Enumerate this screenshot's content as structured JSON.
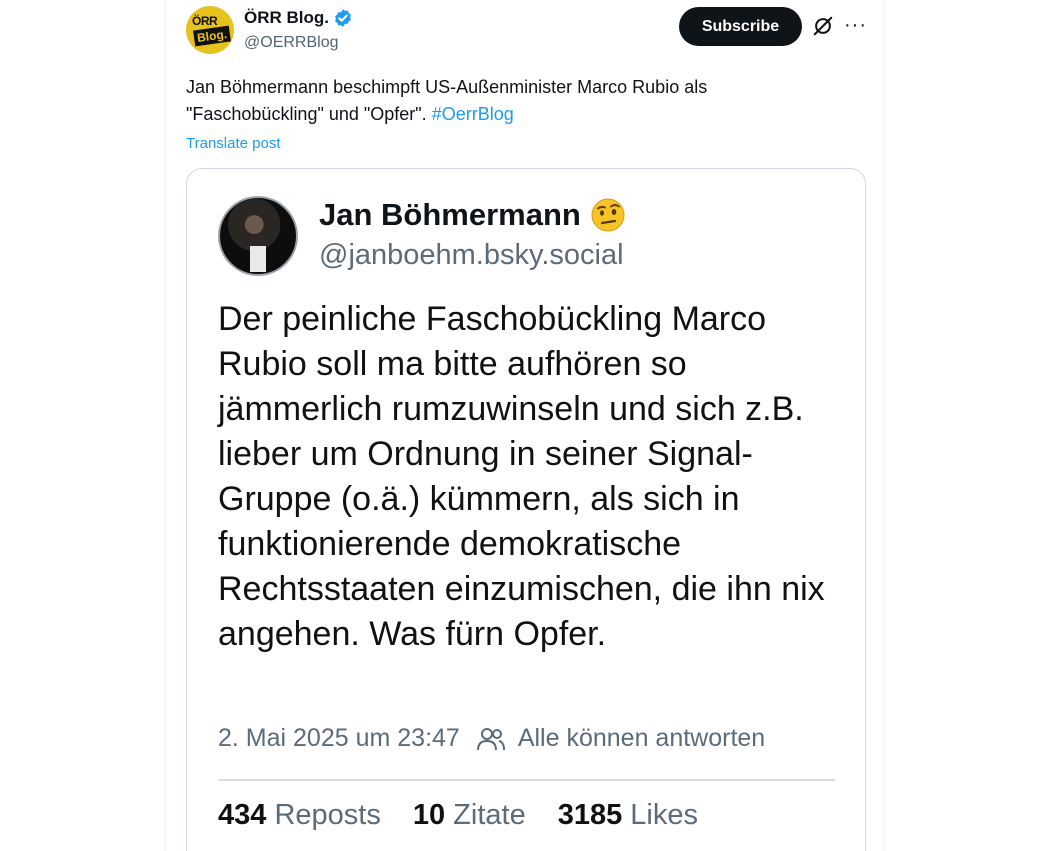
{
  "post": {
    "author": {
      "display_name": "ÖRR Blog.",
      "handle": "@OERRBlog",
      "avatar_text_top": "ÖRR",
      "avatar_text_bottom": "Blog.",
      "verified": true
    },
    "subscribe_label": "Subscribe",
    "more_label": "···",
    "text": "Jan Böhmermann beschimpft US-Außenminister Marco Rubio als \"Faschobückling\" und \"Opfer\". ",
    "hashtag": "#OerrBlog",
    "translate_label": "Translate post"
  },
  "embedded": {
    "name": "Jan Böhmermann",
    "emoji": "🤨",
    "handle": "@janboehm.bsky.social",
    "text": "Der peinliche Faschobückling Marco Rubio soll ma bitte aufhören so jämmerlich rumzuwinseln und sich z.B. lieber um Ordnung in seiner Signal-Gruppe (o.ä.) kümmern, als sich in funktionierende demokratische Rechtsstaaten einzumischen, die ihn nix angehen. Was fürn Opfer.",
    "timestamp": "2. Mai 2025 um 23:47",
    "reply_setting": "Alle können antworten",
    "stats": {
      "reposts_count": "434",
      "reposts_label": "Reposts",
      "quotes_count": "10",
      "quotes_label": "Zitate",
      "likes_count": "3185",
      "likes_label": "Likes"
    }
  },
  "colors": {
    "link": "#1d9bf0",
    "subscribe_bg": "#0f1419",
    "muted": "#536471",
    "avatar_bg": "#e6c21d"
  }
}
